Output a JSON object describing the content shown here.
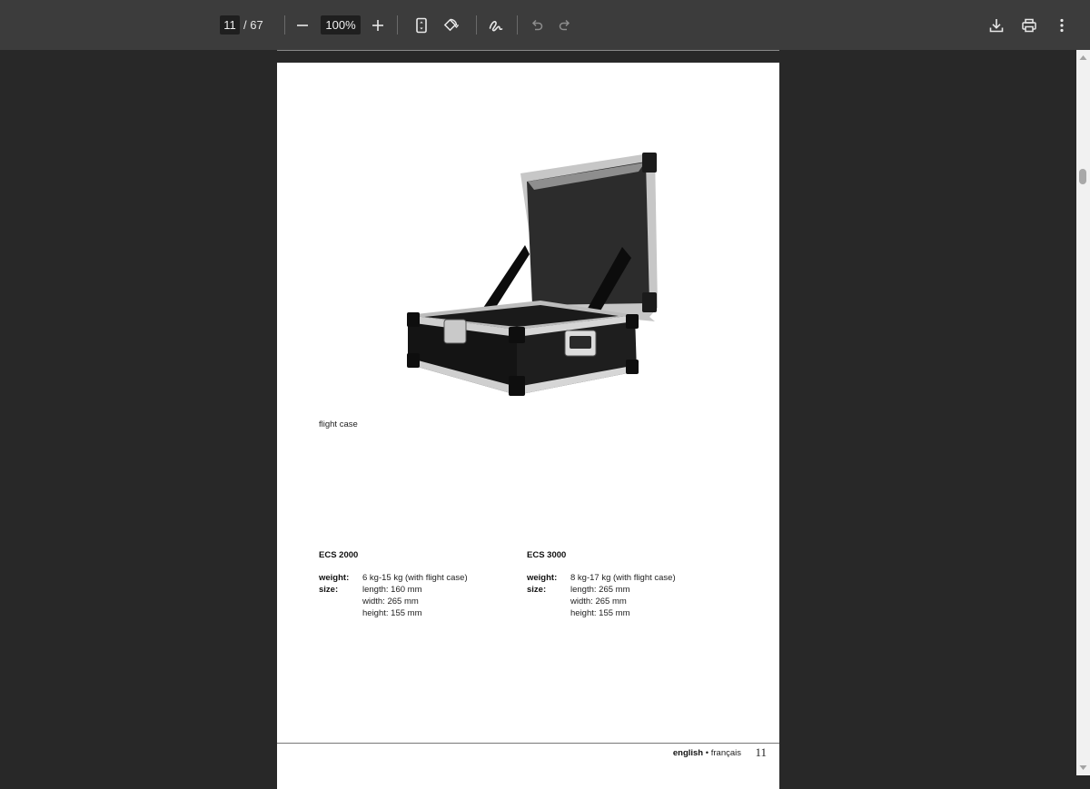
{
  "toolbar": {
    "current_page": "11",
    "total_pages": "/ 67",
    "zoom_value": "100%",
    "icons": [
      "minus-icon",
      "plus-icon",
      "fit-page-icon",
      "rotate-icon",
      "draw-icon",
      "undo-icon",
      "redo-icon",
      "download-icon",
      "print-icon",
      "more-vert-icon"
    ]
  },
  "document": {
    "caption": "flight case",
    "models": [
      {
        "name": "ECS 2000",
        "weight_label": "weight:",
        "weight": "6 kg-15 kg (with flight case)",
        "size_label": "size:",
        "length": "length: 160 mm",
        "width": "width: 265 mm",
        "height": "height: 155 mm"
      },
      {
        "name": "ECS 3000",
        "weight_label": "weight:",
        "weight": "8 kg-17 kg (with flight case)",
        "size_label": "size:",
        "length": "length: 265 mm",
        "width": "width: 265 mm",
        "height": "height: 155 mm"
      }
    ],
    "footer_lang_bold": "english",
    "footer_lang_rest": " • français",
    "page_number": "11"
  },
  "colors": {
    "toolbar_bg": "#3c3c3c",
    "viewer_bg": "#282828",
    "page_bg": "#ffffff"
  }
}
